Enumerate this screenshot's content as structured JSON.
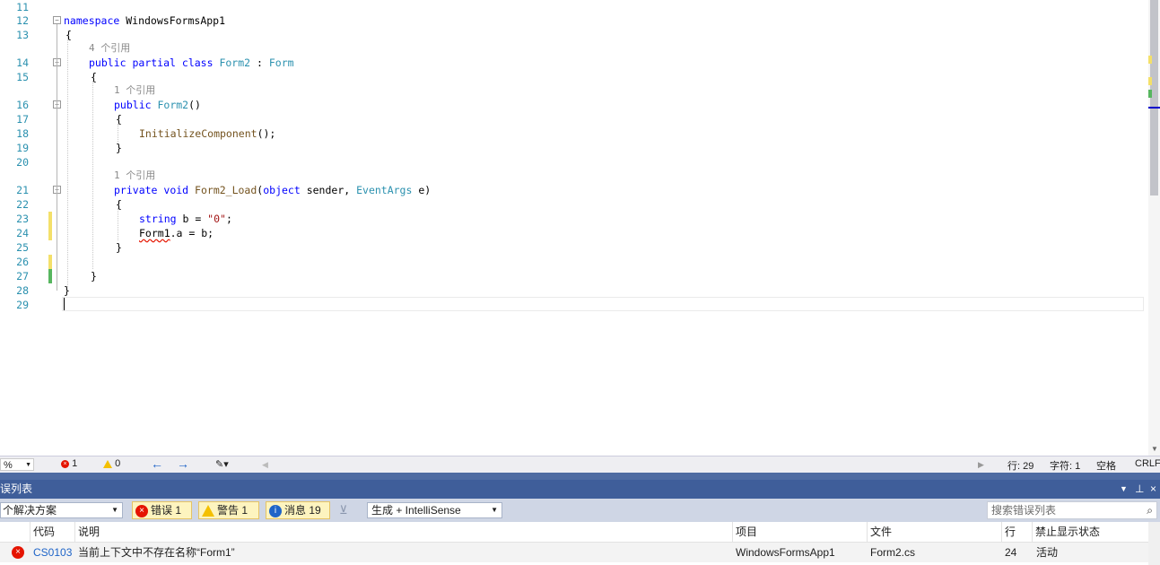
{
  "editor": {
    "lines": [
      {
        "n": "11"
      },
      {
        "n": "12"
      },
      {
        "n": "13"
      },
      {
        "n": "14"
      },
      {
        "n": "15"
      },
      {
        "n": "16"
      },
      {
        "n": "17"
      },
      {
        "n": "18"
      },
      {
        "n": "19"
      },
      {
        "n": "20"
      },
      {
        "n": "21"
      },
      {
        "n": "22"
      },
      {
        "n": "23"
      },
      {
        "n": "24"
      },
      {
        "n": "25"
      },
      {
        "n": "26"
      },
      {
        "n": "27"
      },
      {
        "n": "28"
      },
      {
        "n": "29"
      }
    ],
    "code": {
      "ns_kw": "namespace",
      "ns_name": " WindowsFormsApp1",
      "brace_open": "{",
      "brace_close": "}",
      "lens_4": "4 个引用",
      "lens_1": "1 个引用",
      "class_public": "public",
      "class_partial": "partial",
      "class_kw": "class",
      "class_name": "Form2",
      "class_colon": " : ",
      "class_base": "Form",
      "ctor_public": "public",
      "ctor_name": "Form2",
      "ctor_parens": "()",
      "init_call": "InitializeComponent",
      "init_tail": "();",
      "m_private": "private",
      "m_void": "void",
      "m_name": "Form2_Load",
      "m_p1": "(",
      "m_object": "object",
      "m_sender": " sender, ",
      "m_eventargs": "EventArgs",
      "m_e": " e)",
      "s_kw": "string",
      "s_mid": " b = ",
      "s_lit": "\"0\"",
      "s_end": ";",
      "a_form": "Form1",
      "a_rest": ".a = b;"
    }
  },
  "status": {
    "zoom": "%",
    "errors": "1",
    "warnings": "0",
    "line": "行: 29",
    "char": "字符: 1",
    "space": "空格",
    "eol": "CRLF"
  },
  "error_list": {
    "title": "误列表",
    "scope": "个解决方案",
    "errors_btn": "错误 1",
    "warnings_btn": "警告 1",
    "messages_btn": "消息 19",
    "build_filter": "生成 + IntelliSense",
    "search_placeholder": "搜索错误列表",
    "columns": [
      "代码",
      "说明",
      "项目",
      "文件",
      "行",
      "禁止显示状态"
    ],
    "rows": [
      {
        "code": "CS0103",
        "desc": "当前上下文中不存在名称“Form1”",
        "project": "WindowsFormsApp1",
        "file": "Form2.cs",
        "line": "24",
        "state": "活动"
      }
    ]
  },
  "colors": {
    "keyword": "#0000ff",
    "type": "#2b91af",
    "method": "#74531f",
    "string": "#a31515",
    "panel_header": "#3f5e9a",
    "error": "#e51400"
  },
  "icons": [
    "collapse-minus-icon",
    "error-icon",
    "warning-icon",
    "info-icon",
    "nav-back-icon",
    "nav-forward-icon",
    "brush-icon",
    "search-icon",
    "pin-icon",
    "close-icon",
    "chevron-down-icon",
    "filter-icon"
  ]
}
